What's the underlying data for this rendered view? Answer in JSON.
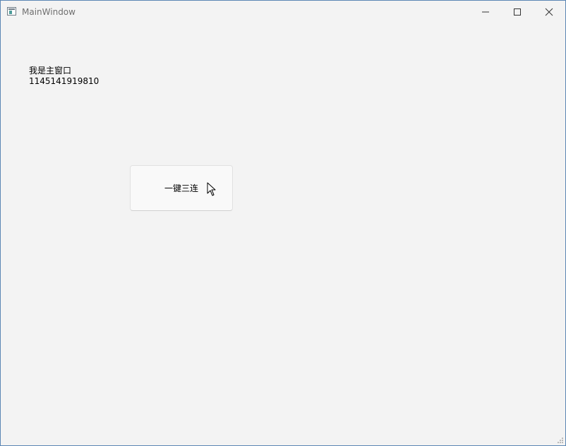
{
  "window": {
    "title": "MainWindow",
    "icon": "application-window-icon"
  },
  "titlebar": {
    "controls": [
      "minimize-icon",
      "maximize-icon",
      "close-icon"
    ]
  },
  "main": {
    "label_line_1": "我是主窗口",
    "label_line_2": "1145141919810",
    "button_label": "一键三连"
  },
  "cursor": {
    "icon": "mouse-pointer-icon"
  },
  "colors": {
    "window_background": "#f3f3f3",
    "button_background": "#f9f9f9",
    "button_border": "#e1e1e1"
  }
}
